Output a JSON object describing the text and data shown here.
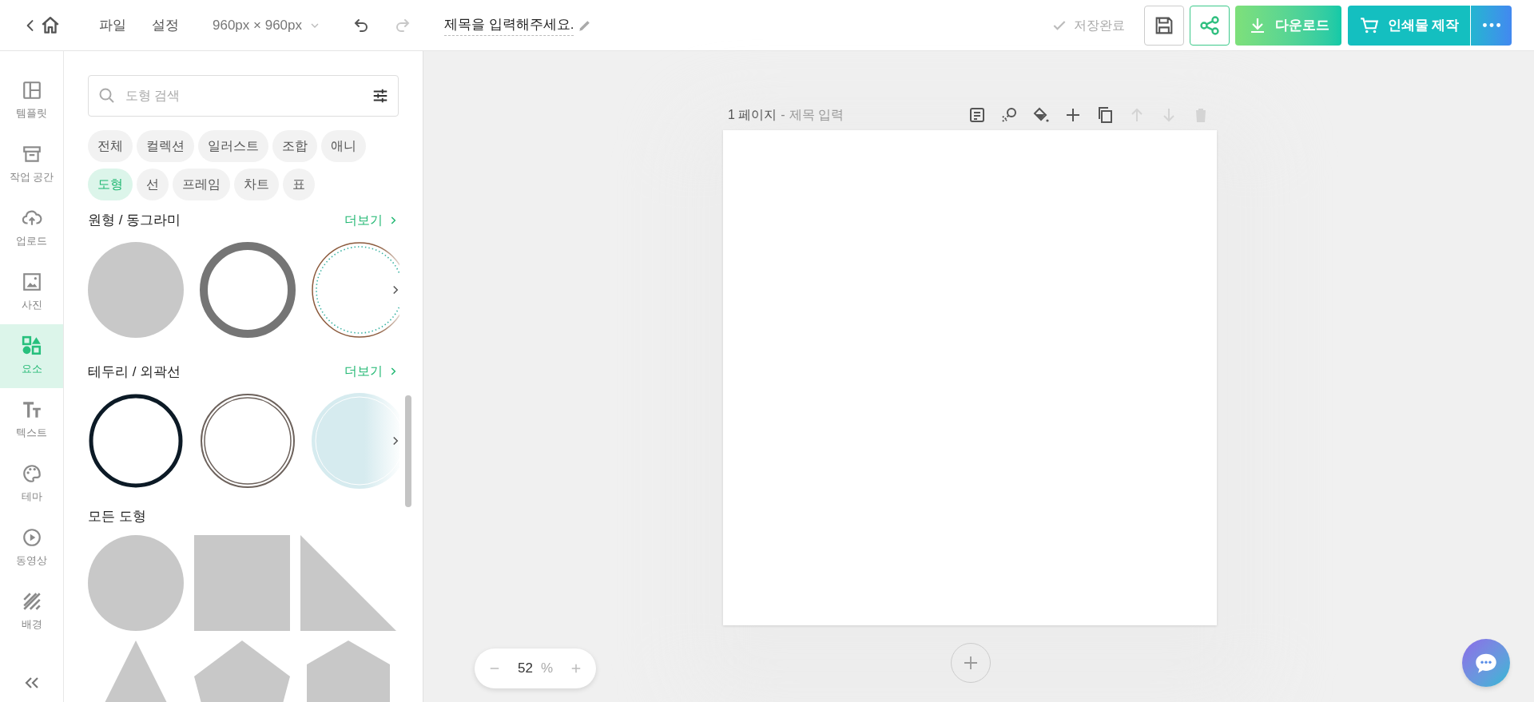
{
  "topbar": {
    "menu": [
      "파일",
      "설정"
    ],
    "size": "960px × 960px",
    "history": [
      {
        "kind": "undo",
        "disabled": false
      },
      {
        "kind": "redo",
        "disabled": true
      }
    ],
    "title": "제목을 입력해주세요.",
    "save_status": "저장완료",
    "download": "다운로드",
    "print": "인쇄물 제작"
  },
  "rail": [
    {
      "kind": "template",
      "label": "템플릿",
      "selected": false
    },
    {
      "kind": "workspace",
      "label": "작업 공간",
      "selected": false
    },
    {
      "kind": "upload",
      "label": "업로드",
      "selected": false
    },
    {
      "kind": "photo",
      "label": "사진",
      "selected": false
    },
    {
      "kind": "elements",
      "label": "요소",
      "selected": true
    },
    {
      "kind": "text",
      "label": "텍스트",
      "selected": false
    },
    {
      "kind": "theme",
      "label": "테마",
      "selected": false
    },
    {
      "kind": "video",
      "label": "동영상",
      "selected": false
    },
    {
      "kind": "background",
      "label": "배경",
      "selected": false
    }
  ],
  "panel": {
    "search": {
      "placeholder": "도형 검색"
    },
    "chips": [
      [
        {
          "label": "전체",
          "selected": false
        },
        {
          "label": "컬렉션",
          "selected": false
        },
        {
          "label": "일러스트",
          "selected": false
        },
        {
          "label": "조합",
          "selected": false
        },
        {
          "label": "애니",
          "selected": false
        }
      ],
      [
        {
          "label": "도형",
          "selected": true
        },
        {
          "label": "선",
          "selected": false
        },
        {
          "label": "프레임",
          "selected": false
        },
        {
          "label": "차트",
          "selected": false
        },
        {
          "label": "표",
          "selected": false
        }
      ]
    ],
    "sections": [
      {
        "kind": "circles",
        "title": "원형 / 동그라미",
        "more": "더보기"
      },
      {
        "kind": "borders",
        "title": "테두리 / 외곽선",
        "more": "더보기"
      },
      {
        "kind": "shapes",
        "title": "모든 도형"
      }
    ]
  },
  "page": {
    "number": "1 페이지",
    "separator": "-",
    "title_placeholder": "제목 입력",
    "tools": [
      {
        "kind": "memo",
        "disabled": false
      },
      {
        "kind": "magic",
        "disabled": false
      },
      {
        "kind": "fill",
        "disabled": false
      },
      {
        "kind": "add",
        "disabled": false
      },
      {
        "kind": "copy",
        "disabled": false
      },
      {
        "kind": "up",
        "disabled": true
      },
      {
        "kind": "down",
        "disabled": true
      },
      {
        "kind": "delete",
        "disabled": true
      }
    ]
  },
  "zoom": {
    "value": "52",
    "unit": "%"
  }
}
